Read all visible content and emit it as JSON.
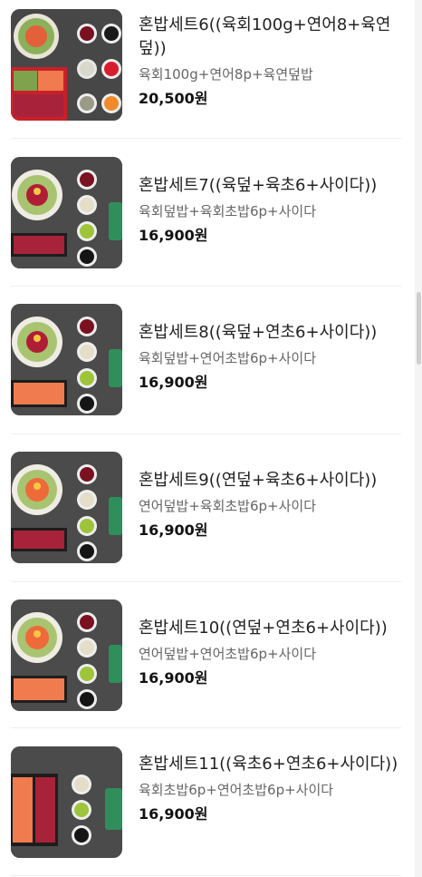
{
  "menu": {
    "items": [
      {
        "name": "혼밥세트6((육회100g+연어8+육연덮))",
        "desc": "육회100g+연어8p+육연덮밥",
        "price": "20,500원",
        "image": "set6-photo"
      },
      {
        "name": "혼밥세트7((육덮+육초6+사이다))",
        "desc": "육회덮밥+육회초밥6p+사이다",
        "price": "16,900원",
        "image": "set7-photo"
      },
      {
        "name": "혼밥세트8((육덮+연초6+사이다))",
        "desc": "육회덮밥+연어초밥6p+사이다",
        "price": "16,900원",
        "image": "set8-photo"
      },
      {
        "name": "혼밥세트9((연덮+육초6+사이다))",
        "desc": "연어덮밥+육회초밥6p+사이다",
        "price": "16,900원",
        "image": "set9-photo"
      },
      {
        "name": "혼밥세트10((연덮+연초6+사이다))",
        "desc": "연어덮밥+연어초밥6p+사이다",
        "price": "16,900원",
        "image": "set10-photo"
      },
      {
        "name": "혼밥세트11((육초6+연초6+사이다))",
        "desc": "육회초밥6p+연어초밥6p+사이다",
        "price": "16,900원",
        "image": "set11-photo"
      }
    ]
  },
  "colors": {
    "salmon": "#f07b4e",
    "beef": "#a8233a",
    "background": "#4a4a4a",
    "can": "#2f8f5b"
  }
}
